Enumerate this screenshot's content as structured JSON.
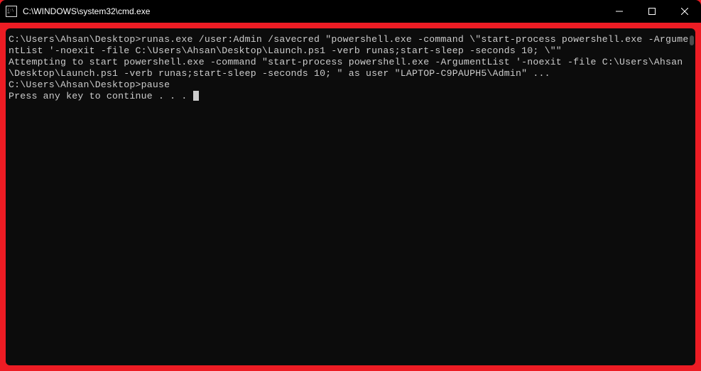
{
  "window": {
    "title": "C:\\WINDOWS\\system32\\cmd.exe"
  },
  "terminal": {
    "line1": "C:\\Users\\Ahsan\\Desktop>runas.exe /user:Admin /savecred \"powershell.exe -command \\\"start-process powershell.exe -ArgumentList '-noexit -file C:\\Users\\Ahsan\\Desktop\\Launch.ps1 -verb runas;start-sleep -seconds 10; \\\"\"",
    "line2": "Attempting to start powershell.exe -command \"start-process powershell.exe -ArgumentList '-noexit -file C:\\Users\\Ahsan\\Desktop\\Launch.ps1 -verb runas;start-sleep -seconds 10; \" as user \"LAPTOP-C9PAUPH5\\Admin\" ...",
    "line3": "",
    "line4": "C:\\Users\\Ahsan\\Desktop>pause",
    "line5": "Press any key to continue . . . "
  }
}
